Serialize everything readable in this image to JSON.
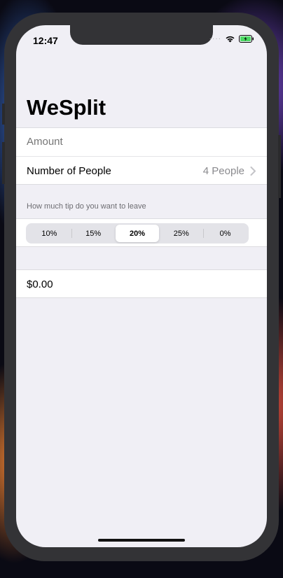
{
  "status_bar": {
    "time": "12:47",
    "signal": "····"
  },
  "nav": {
    "title": "WeSplit"
  },
  "form": {
    "amount_placeholder": "Amount",
    "people_label": "Number of People",
    "people_value": "4 People"
  },
  "tip_section": {
    "header": "How much tip do you want to leave",
    "options": [
      "10%",
      "15%",
      "20%",
      "25%",
      "0%"
    ],
    "selected": "20%"
  },
  "total": {
    "value": "$0.00"
  }
}
